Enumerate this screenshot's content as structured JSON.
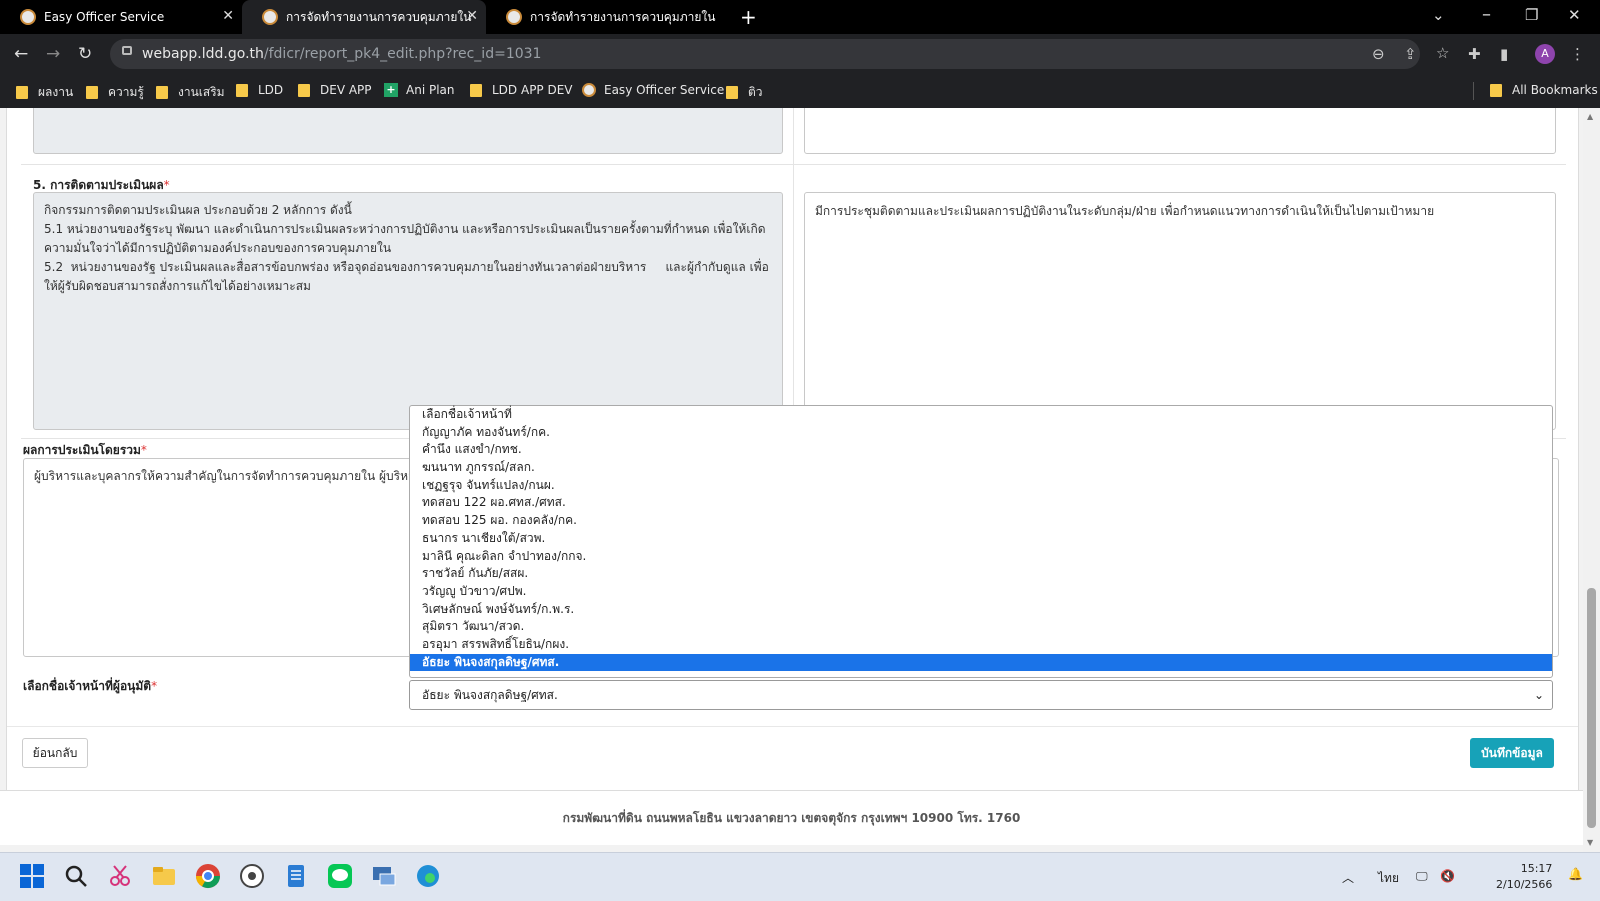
{
  "browser": {
    "tabs": [
      {
        "title": "Easy Officer Service"
      },
      {
        "title": "การจัดทำรายงานการควบคุมภายใน"
      },
      {
        "title": "การจัดทำรายงานการควบคุมภายใน"
      }
    ],
    "url_host": "webapp.ldd.go.th",
    "url_path": "/fdicr/report_pk4_edit.php?rec_id=1031",
    "profile_initial": "A",
    "bookmarks": [
      "ผลงาน",
      "ความรู้",
      "งานเสริม",
      "LDD",
      "DEV APP",
      "Ani Plan",
      "LDD APP DEV",
      "Easy Officer Service",
      "ติว"
    ],
    "all_bookmarks": "All Bookmarks"
  },
  "form": {
    "section5_label": "5. การติดตามประเมินผล",
    "required_mark": "*",
    "section5_left_text": "กิจกรรมการติดตามประเมินผล ประกอบด้วย 2 หลักการ ดังนี้\n5.1 หน่วยงานของรัฐระบุ พัฒนา และดำเนินการประเมินผลระหว่างการปฏิบัติงาน และหรือการประเมินผลเป็นรายครั้งตามที่กำหนด เพื่อให้เกิดความมั่นใจว่าได้มีการปฏิบัติตามองค์ประกอบของการควบคุมภายใน\n5.2  หน่วยงานของรัฐ ประเมินผลและสื่อสารข้อบกพร่อง หรือจุดอ่อนของการควบคุมภายในอย่างทันเวลาต่อฝ่ายบริหาร     และผู้กำกับดูแล เพื่อให้ผู้รับผิดชอบสามารถสั่งการแก้ไขได้อย่างเหมาะสม",
    "section5_right_text": "มีการประชุมติดตามและประเมินผลการปฏิบัติงานในระดับกลุ่ม/ฝ่าย เพื่อกำหนดแนวทางการดำเนินให้เป็นไปตามเป้าหมาย",
    "overall_label": "ผลการประเมินโดยรวม",
    "overall_text": "ผู้บริหารและบุคลากรให้ความสำคัญในการจัดทำการควบคุมภายใน ผู้บริหาร",
    "approver_label": "เลือกชื่อเจ้าหน้าที่ผู้อนุมัติ",
    "approver_selected": "อัธยะ พินจงสกุลดิษฐ/ศทส.",
    "approver_options": [
      "เลือกชื่อเจ้าหน้าที่",
      "กัญญาภัค ทองจันทร์/กค.",
      "คำนึง แสงขำ/กทช.",
      "ฆนนาท ภูกรรณ์/สลก.",
      "เชฏฐรุจ จันทร์แปลง/กนผ.",
      "ทดสอบ 122 ผอ.ศทส./ศทส.",
      "ทดสอบ 125 ผอ. กองคลัง/กค.",
      "ธนากร นาเชียงใต้/สวพ.",
      "มาลินี คุณะดิลก จำปาทอง/กกจ.",
      "ราชวัลย์ กันภัย/สสผ.",
      "วรัญญู บัวขาว/ศปพ.",
      "วิเศษลักษณ์ พงษ์จันทร์/ก.พ.ร.",
      "สุมิตรา วัฒนา/สวด.",
      "อรอุมา สรรพสิทธิ์โยธิน/กผง.",
      "อัธยะ พินจงสกุลดิษฐ/ศทส."
    ],
    "back_label": "ย้อนกลับ",
    "save_label": "บันทึกข้อมูล"
  },
  "footer": {
    "text": "กรมพัฒนาที่ดิน ถนนพหลโยธิน แขวงลาดยาว เขตจตุจักร กรุงเทพฯ 10900 โทร. 1760"
  },
  "taskbar": {
    "language": "ไทย",
    "time": "15:17",
    "date": "2/10/2566"
  },
  "colors": {
    "accent": "#17a2b8",
    "selected_option": "#1a73e8",
    "readonly_bg": "#e9ecef"
  }
}
